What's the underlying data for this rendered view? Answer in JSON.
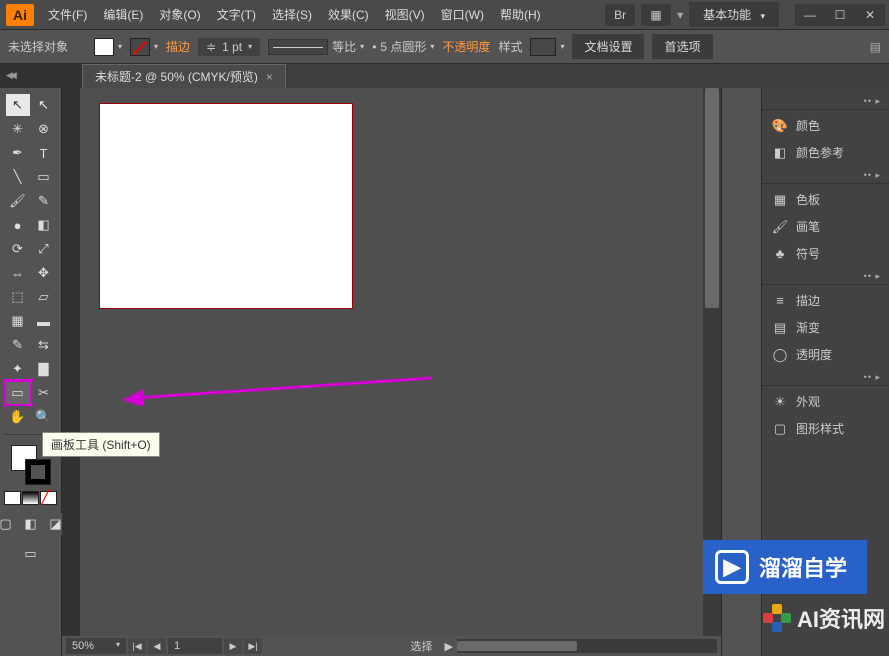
{
  "app": {
    "logo": "Ai"
  },
  "menu": {
    "file": "文件(F)",
    "edit": "编辑(E)",
    "object": "对象(O)",
    "type": "文字(T)",
    "select": "选择(S)",
    "effect": "效果(C)",
    "view": "视图(V)",
    "window": "窗口(W)",
    "help": "帮助(H)"
  },
  "workspace": {
    "label": "基本功能"
  },
  "controlbar": {
    "noSelection": "未选择对象",
    "strokeLabel": "描边",
    "strokeWeight": "1 pt",
    "scaleLabel": "等比",
    "brushLabel": "5 点圆形",
    "opacityLabel": "不透明度",
    "styleLabel": "样式",
    "docSetup": "文档设置",
    "prefs": "首选项"
  },
  "doc": {
    "tabTitle": "未标题-2 @ 50% (CMYK/预览)",
    "close": "×"
  },
  "tooltip": {
    "text": "画板工具 (Shift+O)"
  },
  "statusbar": {
    "zoom": "50%",
    "page": "1",
    "selectLabel": "选择"
  },
  "panels": {
    "color": "颜色",
    "colorGuide": "颜色参考",
    "swatches": "色板",
    "brushes": "画笔",
    "symbols": "符号",
    "stroke": "描边",
    "gradient": "渐变",
    "transparency": "透明度",
    "appearance": "外观",
    "graphicStyles": "图形样式"
  },
  "watermark": {
    "brand1": "溜溜自学",
    "brand2": "AI资讯网"
  },
  "icons": {
    "bridge": "Br",
    "arrange": "▦",
    "dropdown": "▾",
    "search": "🔍",
    "min": "—",
    "max": "☐",
    "close": "✕",
    "palette": "🎨",
    "guide": "◧",
    "grid": "▦",
    "brush": "🖌",
    "club": "♣",
    "lines": "≡",
    "grad": "▤",
    "circle": "◯",
    "sun": "☀",
    "style": "▢",
    "selArrow": "▲"
  },
  "tools": {
    "selection": "↖",
    "directSelection": "↖",
    "magicWand": "✳",
    "lasso": "⊗",
    "pen": "✒",
    "type": "T",
    "line": "╲",
    "rectangle": "▭",
    "paintbrush": "🖌",
    "pencil": "✎",
    "blob": "●",
    "eraser": "◧",
    "rotate": "⟳",
    "scale": "⤢",
    "width": "⇔",
    "freeTransform": "✥",
    "shapeBuilder": "⬚",
    "perspective": "▱",
    "mesh": "▦",
    "gradient": "▬",
    "eyedropper": "✎",
    "blend": "⇆",
    "symbolSpray": "✦",
    "graph": "▇",
    "artboard": "▭",
    "slice": "✂",
    "hand": "✋",
    "zoom": "🔍",
    "colorMode1": "▪",
    "colorMode2": "▥",
    "colorMode3": "╱",
    "screen": "▢",
    "changeScreen": "▭"
  }
}
